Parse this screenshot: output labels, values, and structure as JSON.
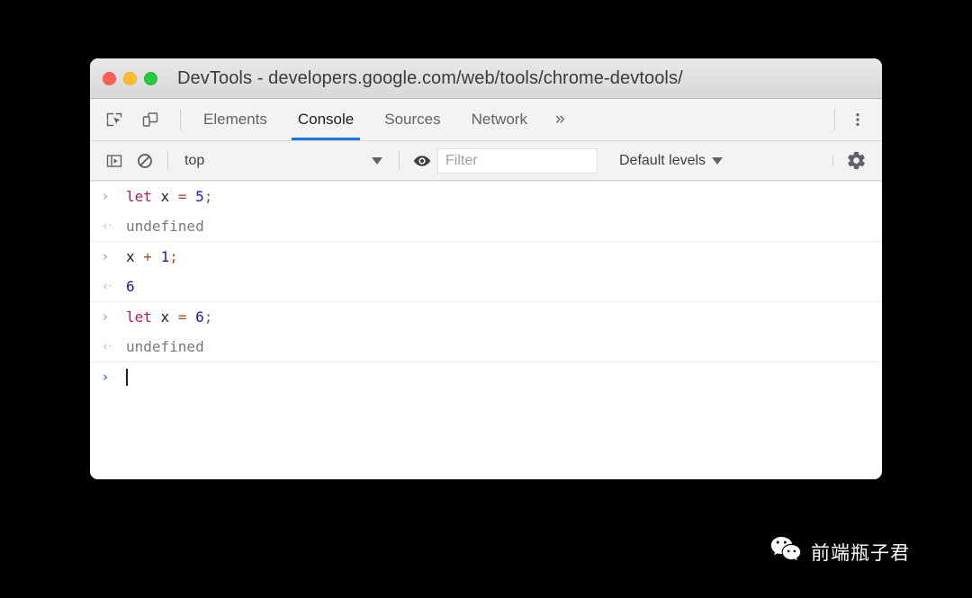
{
  "window": {
    "title": "DevTools - developers.google.com/web/tools/chrome-devtools/",
    "traffic_lights": [
      {
        "name": "close",
        "color": "#ff5f56"
      },
      {
        "name": "minimize",
        "color": "#febc2e"
      },
      {
        "name": "zoom",
        "color": "#28c840"
      }
    ]
  },
  "tabbar": {
    "inspect_icon": "inspect-element-icon",
    "device_icon": "device-toolbar-icon",
    "tabs": [
      {
        "label": "Elements",
        "active": false
      },
      {
        "label": "Console",
        "active": true
      },
      {
        "label": "Sources",
        "active": false
      },
      {
        "label": "Network",
        "active": false
      }
    ],
    "overflow_label": "»",
    "menu_icon": "kebab-menu-icon"
  },
  "console_toolbar": {
    "sidebar_icon": "console-sidebar-icon",
    "clear_icon": "clear-console-icon",
    "context": {
      "value": "top",
      "caret": "▼"
    },
    "live_expression_icon": "eye-icon",
    "filter": {
      "value": "",
      "placeholder": "Filter"
    },
    "levels": {
      "label": "Default levels",
      "caret": "▼"
    },
    "settings_icon": "gear-icon"
  },
  "console": {
    "groups": [
      {
        "input": {
          "marker": "›",
          "tokens": [
            {
              "text": "let",
              "type": "kw"
            },
            {
              "text": " ",
              "type": "plain"
            },
            {
              "text": "x",
              "type": "var"
            },
            {
              "text": " ",
              "type": "plain"
            },
            {
              "text": "=",
              "type": "op"
            },
            {
              "text": " ",
              "type": "plain"
            },
            {
              "text": "5",
              "type": "num"
            },
            {
              "text": ";",
              "type": "punc"
            }
          ],
          "raw": "let x = 5;"
        },
        "output": {
          "marker": "‹·",
          "text": "undefined",
          "kind": "undefined"
        }
      },
      {
        "input": {
          "marker": "›",
          "tokens": [
            {
              "text": "x",
              "type": "var"
            },
            {
              "text": " ",
              "type": "plain"
            },
            {
              "text": "+",
              "type": "op"
            },
            {
              "text": " ",
              "type": "plain"
            },
            {
              "text": "1",
              "type": "num"
            },
            {
              "text": ";",
              "type": "punc"
            }
          ],
          "raw": "x + 1;"
        },
        "output": {
          "marker": "‹·",
          "text": "6",
          "kind": "value"
        }
      },
      {
        "input": {
          "marker": "›",
          "tokens": [
            {
              "text": "let",
              "type": "kw"
            },
            {
              "text": " ",
              "type": "plain"
            },
            {
              "text": "x",
              "type": "var"
            },
            {
              "text": " ",
              "type": "plain"
            },
            {
              "text": "=",
              "type": "op"
            },
            {
              "text": " ",
              "type": "plain"
            },
            {
              "text": "6",
              "type": "num"
            },
            {
              "text": ";",
              "type": "punc"
            }
          ],
          "raw": "let x = 6;"
        },
        "output": {
          "marker": "‹·",
          "text": "undefined",
          "kind": "undefined"
        }
      }
    ],
    "prompt": {
      "marker": "›",
      "value": ""
    }
  },
  "watermark": {
    "icon": "wechat-icon",
    "text": "前端瓶子君"
  },
  "colors": {
    "accent": "#1a73e8",
    "prompt_blue": "#4285f4",
    "keyword": "#a71d5d",
    "number": "#1a1aa6",
    "operator": "#a0522d",
    "background": "#000000"
  }
}
